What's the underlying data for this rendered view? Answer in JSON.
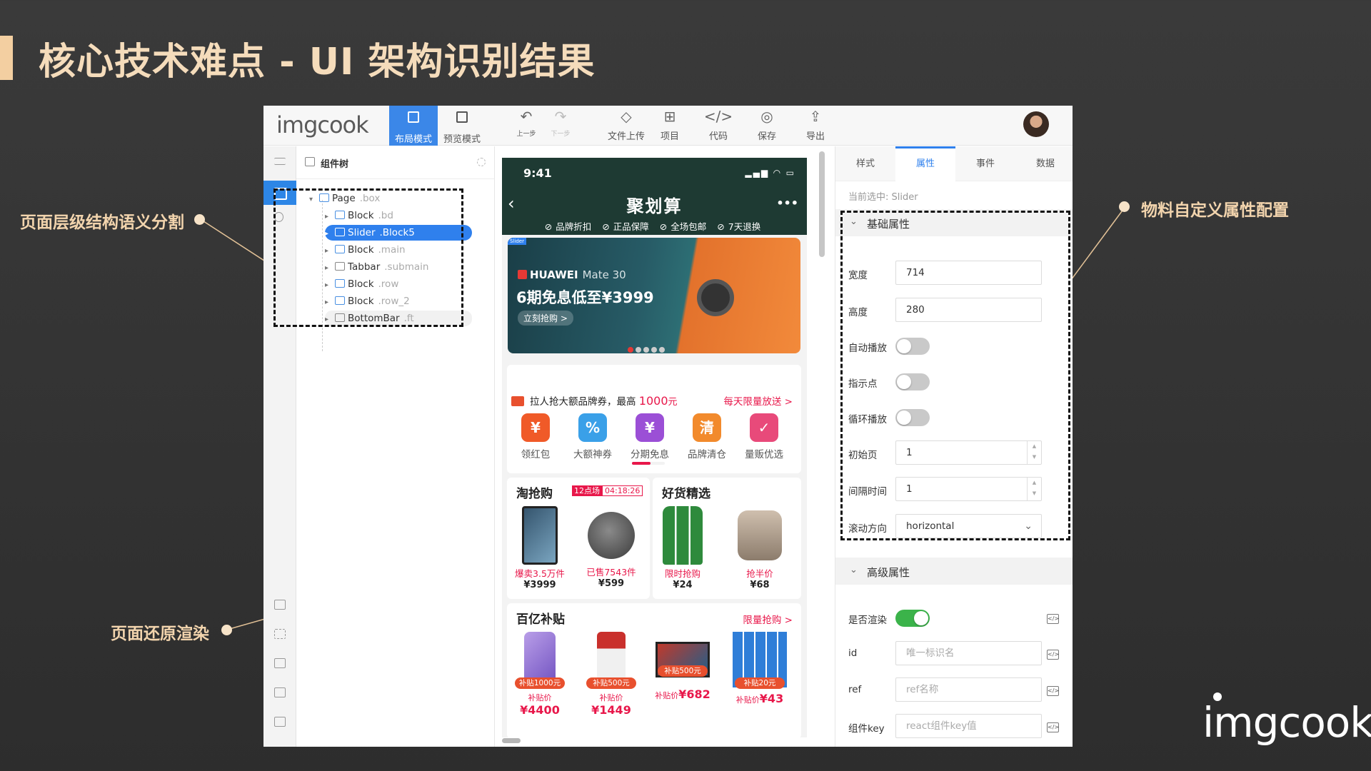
{
  "slide": {
    "title": "核心技术难点 - UI 架构识别结果",
    "brand": "imgcook",
    "annotations": {
      "left_top": "页面层级结构语义分割",
      "left_bottom": "页面还原渲染",
      "right": "物料自定义属性配置"
    }
  },
  "toolbar": {
    "logo": "imgcook",
    "modes": [
      {
        "label": "布局模式",
        "active": true
      },
      {
        "label": "预览模式",
        "active": false
      }
    ],
    "undo": "上一步",
    "redo": "下一步",
    "tools": [
      "文件上传",
      "项目",
      "代码",
      "保存",
      "导出"
    ]
  },
  "tree": {
    "header": "组件树",
    "nodes": [
      {
        "name": "Page",
        "cls": ".box"
      },
      {
        "name": "Block",
        "cls": ".bd"
      },
      {
        "name": "Slider",
        "cls": ".Block5",
        "selected": true
      },
      {
        "name": "Block",
        "cls": ".main"
      },
      {
        "name": "Tabbar",
        "cls": ".submain"
      },
      {
        "name": "Block",
        "cls": ".row"
      },
      {
        "name": "Block",
        "cls": ".row_2"
      },
      {
        "name": "BottomBar",
        "cls": ".ft"
      }
    ]
  },
  "phone": {
    "time": "9:41",
    "nav_title": "聚划算",
    "nav_tags": [
      "品牌折扣",
      "正品保障",
      "全场包邮",
      "7天退换"
    ],
    "banner": {
      "badge": "Slider",
      "brand": "HUAWEI",
      "model": "Mate 30",
      "headline": "6期免息低至¥3999",
      "button": "立刻抢购 >"
    },
    "coupon": {
      "text": "拉人抢大额品牌券，最高",
      "amount": "1000",
      "unit": "元",
      "right": "每天限量放送 >"
    },
    "categories": [
      {
        "label": "领红包",
        "color": "#f05a28",
        "glyph": "¥"
      },
      {
        "label": "大额神券",
        "color": "#3aa0e8",
        "glyph": "%"
      },
      {
        "label": "分期免息",
        "color": "#9b4fd6",
        "glyph": "¥"
      },
      {
        "label": "品牌清仓",
        "color": "#f28a2c",
        "glyph": "清"
      },
      {
        "label": "量贩优选",
        "color": "#e84a7a",
        "glyph": "✓"
      }
    ],
    "section1": {
      "title": "淘抢购",
      "timer_label": "12点场",
      "timer_time": "04:18:26"
    },
    "section2": {
      "title": "好货精选"
    },
    "products": [
      {
        "label": "爆卖3.5万件",
        "price": "¥3999"
      },
      {
        "label": "已售7543件",
        "price": "¥599"
      },
      {
        "label": "限时抢购",
        "price": "¥24"
      },
      {
        "label": "抢半价",
        "price": "¥68"
      }
    ],
    "section3": {
      "title": "百亿补贴",
      "right": "限量抢购 >"
    },
    "subsidy": [
      {
        "tag": "补贴1000元",
        "prefix": "补贴价",
        "price": "¥4400"
      },
      {
        "tag": "补贴500元",
        "prefix": "补贴价",
        "price": "¥1449"
      },
      {
        "tag": "补贴500元",
        "prefix": "补贴价",
        "price": "¥682"
      },
      {
        "tag": "补贴20元",
        "prefix": "补贴价",
        "price": "¥43"
      }
    ]
  },
  "props": {
    "tabs": [
      "样式",
      "属性",
      "事件",
      "数据"
    ],
    "active_tab": "属性",
    "current": "当前选中: Slider",
    "basic_group": "基础属性",
    "width_label": "宽度",
    "width": "714",
    "height_label": "高度",
    "height": "280",
    "autoplay_label": "自动播放",
    "autoplay": false,
    "dots_label": "指示点",
    "dots": false,
    "loop_label": "循环播放",
    "loop": false,
    "initial_label": "初始页",
    "initial": "1",
    "interval_label": "间隔时间",
    "interval": "1",
    "direction_label": "滚动方向",
    "direction": "horizontal",
    "adv_group": "高级属性",
    "render_label": "是否渲染",
    "render": true,
    "id_label": "id",
    "id_placeholder": "唯一标识名",
    "ref_label": "ref",
    "ref_placeholder": "ref名称",
    "key_label": "组件key",
    "key_placeholder": "react组件key值"
  }
}
